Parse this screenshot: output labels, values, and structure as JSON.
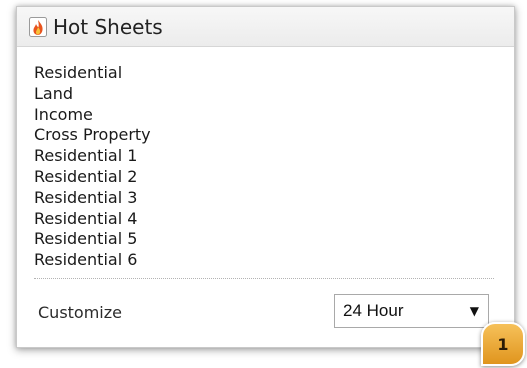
{
  "header": {
    "title": "Hot Sheets",
    "icon": "fire-icon"
  },
  "list": {
    "items": [
      "Residential",
      "Land",
      "Income",
      "Cross Property",
      "Residential 1",
      "Residential 2",
      "Residential 3",
      "Residential 4",
      "Residential 5",
      "Residential 6"
    ]
  },
  "footer": {
    "customize_label": "Customize",
    "select_value": "24 Hour",
    "arrow": "▼"
  },
  "callout": {
    "number": "1"
  },
  "colors": {
    "callout": "#e8a53a",
    "header_bg": "#efefef",
    "flame": "#e8541e"
  }
}
